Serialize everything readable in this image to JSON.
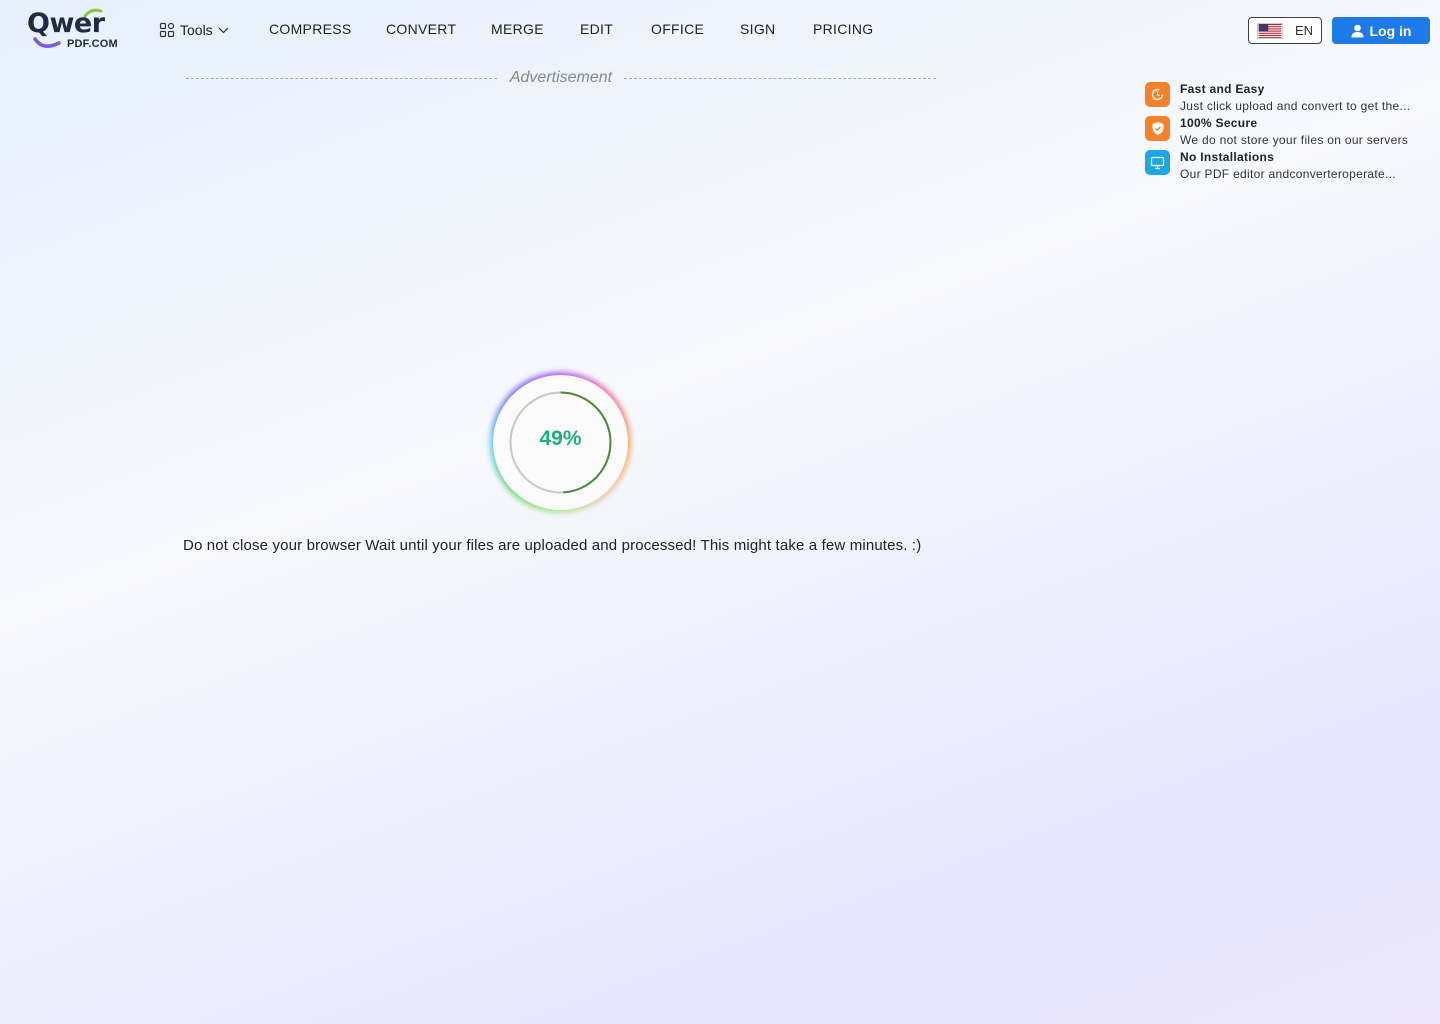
{
  "brand": {
    "logo_word": "Qwer",
    "logo_sub": "PDF.COM"
  },
  "header": {
    "tools_label": "Tools",
    "nav": [
      "COMPRESS",
      "CONVERT",
      "MERGE",
      "EDIT",
      "OFFICE",
      "SIGN",
      "PRICING"
    ],
    "language": "EN",
    "login_label": "Log in"
  },
  "advertisement": {
    "label": "Advertisement"
  },
  "features": [
    {
      "title": "Fast and Easy",
      "desc": "Just click upload and convert to get the...",
      "icon": "clock-icon",
      "color": "#f5812b"
    },
    {
      "title": "100% Secure",
      "desc": "We do not store your files on our servers",
      "icon": "shield-icon",
      "color": "#f5812b"
    },
    {
      "title": "No Installations",
      "desc": "Our PDF editor andconverteroperate...",
      "icon": "monitor-icon",
      "color": "#1aa9e6"
    }
  ],
  "progress": {
    "percent_label": "49%",
    "fraction": 0.49,
    "color": "#1fb07a"
  },
  "message": "Do not close your browser Wait until your files are uploaded and processed! This might take a few minutes. :)"
}
